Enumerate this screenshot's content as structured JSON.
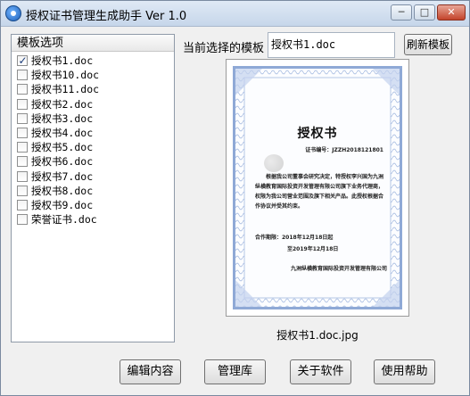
{
  "window": {
    "title": "授权证书管理生成助手 Ver 1.0",
    "controls": {
      "minimize": "─",
      "maximize": "□",
      "close": "✕"
    }
  },
  "template_list": {
    "header": "模板选项",
    "items": [
      {
        "label": "授权书1.doc",
        "checked": true
      },
      {
        "label": "授权书10.doc",
        "checked": false
      },
      {
        "label": "授权书11.doc",
        "checked": false
      },
      {
        "label": "授权书2.doc",
        "checked": false
      },
      {
        "label": "授权书3.doc",
        "checked": false
      },
      {
        "label": "授权书4.doc",
        "checked": false
      },
      {
        "label": "授权书5.doc",
        "checked": false
      },
      {
        "label": "授权书6.doc",
        "checked": false
      },
      {
        "label": "授权书7.doc",
        "checked": false
      },
      {
        "label": "授权书8.doc",
        "checked": false
      },
      {
        "label": "授权书9.doc",
        "checked": false
      },
      {
        "label": "荣誉证书.doc",
        "checked": false
      }
    ]
  },
  "current": {
    "label": "当前选择的模板",
    "value": "授权书1.doc",
    "refresh_label": "刷新模板"
  },
  "preview": {
    "caption": "授权书1.doc.jpg",
    "certificate": {
      "title": "授权书",
      "number": "证书编号：JZZH2018121801",
      "body": "根据我公司董事会研究决定，特授权李兴国为九洲纵横教育国际投资开发管理有限公司旗下业务代理商，权限为我公司营业范围及旗下相关产品。此授权根据合作协议并受其约束。",
      "period_start": "合作期限：2018年12月18日起",
      "period_end": "至2019年12月18日",
      "organization": "九洲纵横教育国际投资开发管理有限公司"
    }
  },
  "buttons": {
    "edit": "编辑内容",
    "library": "管理库",
    "about": "关于软件",
    "help": "使用帮助"
  }
}
